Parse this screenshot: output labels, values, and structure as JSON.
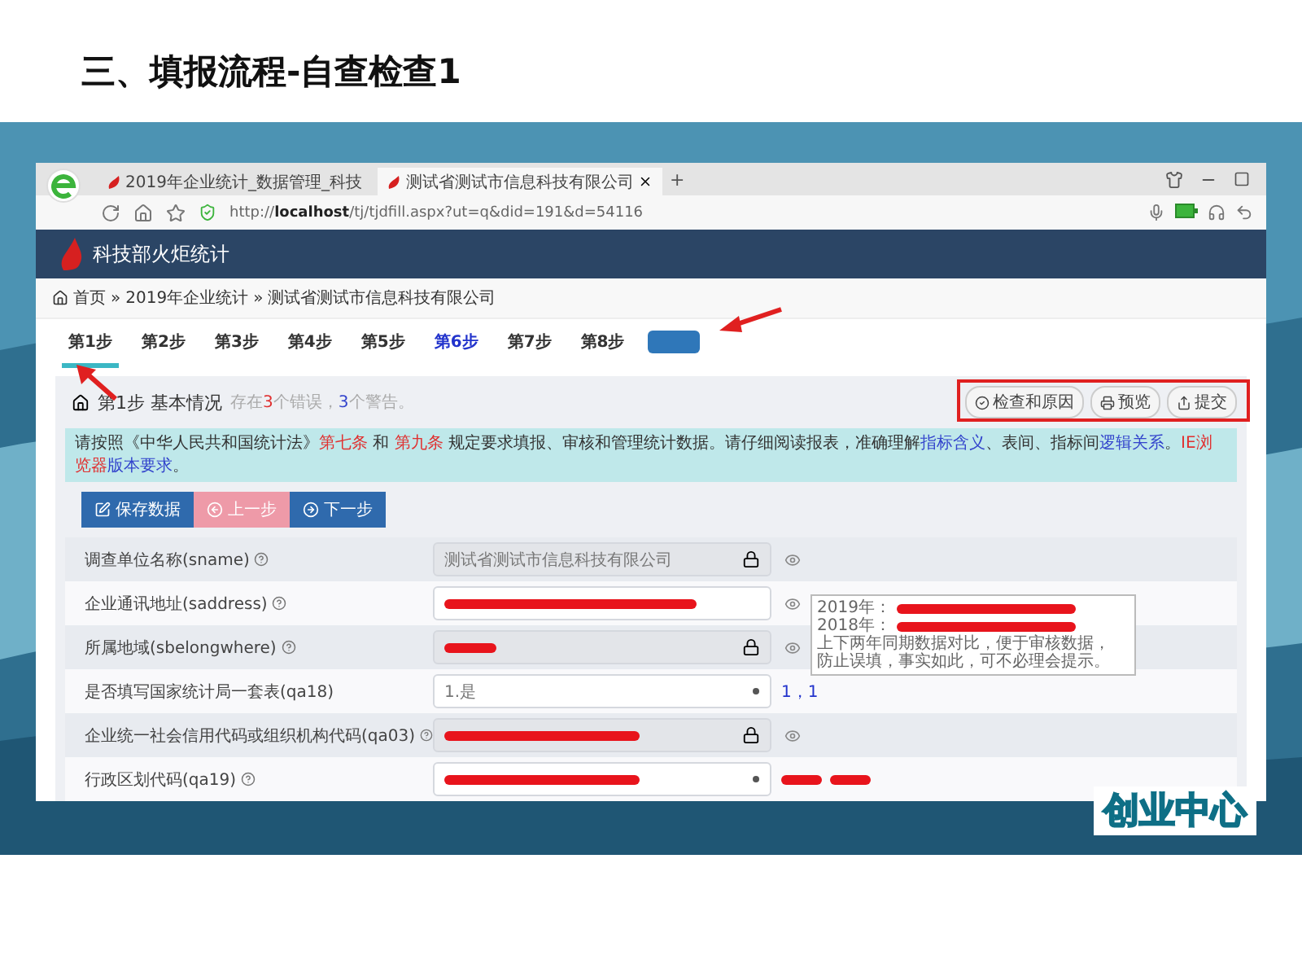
{
  "slide_title": "三、填报流程-自查检查1",
  "browser": {
    "tabs": [
      {
        "title": "2019年企业统计_数据管理_科技",
        "selected": false,
        "closable": false
      },
      {
        "title": "测试省测试市信息科技有限公司",
        "selected": true,
        "closable": true
      }
    ],
    "new_tab": "+",
    "url": {
      "scheme": "http://",
      "host": "localhost",
      "path": "/tj/tjdfill.aspx?ut=q&did=191&d=54116"
    }
  },
  "site": {
    "title": "科技部火炬统计",
    "breadcrumb": [
      "首页",
      "2019年企业统计",
      "测试省测试市信息科技有限公司"
    ],
    "breadcrumb_separator": "»",
    "steps": [
      {
        "label": "第1步",
        "selected": true,
        "highlighted": false
      },
      {
        "label": "第2步",
        "selected": false,
        "highlighted": false
      },
      {
        "label": "第3步",
        "selected": false,
        "highlighted": false
      },
      {
        "label": "第4步",
        "selected": false,
        "highlighted": false
      },
      {
        "label": "第5步",
        "selected": false,
        "highlighted": false
      },
      {
        "label": "第6步",
        "selected": false,
        "highlighted": true
      },
      {
        "label": "第7步",
        "selected": false,
        "highlighted": false
      },
      {
        "label": "第8步",
        "selected": false,
        "highlighted": false
      },
      {
        "kind": "blank"
      }
    ],
    "panel_title": "第1步 基本情况",
    "status": [
      {
        "text": "存在",
        "kind": "plain"
      },
      {
        "text": "3",
        "kind": "error"
      },
      {
        "text": "个错误，",
        "kind": "plain"
      },
      {
        "text": "3",
        "kind": "warning"
      },
      {
        "text": "个警告。",
        "kind": "plain"
      }
    ],
    "actions": [
      "检查和原因",
      "预览",
      "提交"
    ],
    "notice": [
      {
        "text": "请按照《中华人民共和国统计法》",
        "kind": "plain"
      },
      {
        "text": "第七条",
        "kind": "red"
      },
      {
        "text": " 和 ",
        "kind": "plain"
      },
      {
        "text": "第九条",
        "kind": "red"
      },
      {
        "text": " 规定要求填报、审核和管理统计数据。请仔细阅读报表，准确理解",
        "kind": "plain"
      },
      {
        "text": "指标含义",
        "kind": "link"
      },
      {
        "text": "、表间、指标间",
        "kind": "plain"
      },
      {
        "text": "逻辑关系",
        "kind": "link"
      },
      {
        "text": "。",
        "kind": "plain"
      },
      {
        "text": "IE浏览器",
        "kind": "red"
      },
      {
        "text": "版本要求",
        "kind": "link"
      },
      {
        "text": "。",
        "kind": "plain"
      }
    ],
    "buttons": [
      {
        "label": "保存数据",
        "disabled": false,
        "kind": "save"
      },
      {
        "label": "上一步",
        "disabled": true,
        "kind": "prev"
      },
      {
        "label": "下一步",
        "disabled": false,
        "kind": "next"
      }
    ],
    "fields": [
      {
        "label": "调查单位名称(sname)",
        "help": true,
        "kind": "locked",
        "value": "测试省测试市信息科技有限公司",
        "redacted": false,
        "eye": true
      },
      {
        "label": "企业通讯地址(saddress)",
        "help": true,
        "kind": "text",
        "redacted": true,
        "eye": true
      },
      {
        "label": "所属地域(sbelongwhere)",
        "help": true,
        "kind": "locked",
        "redacted": true,
        "eye": true
      },
      {
        "label": "是否填写国家统计局一套表(qa18)",
        "help": false,
        "kind": "select",
        "value": "1.是",
        "redacted": false,
        "eye": false,
        "after": "1，1"
      },
      {
        "label": "企业统一社会信用代码或组织机构代码(qa03)",
        "help": true,
        "kind": "locked",
        "redacted": true,
        "eye": true
      },
      {
        "label": "行政区划代码(qa19)",
        "help": true,
        "kind": "select",
        "redacted": true,
        "eye": false,
        "after_redacted": true
      }
    ],
    "tooltip": [
      {
        "text": "2019年：",
        "redacted": true
      },
      {
        "text": "2018年：",
        "redacted": true
      },
      {
        "text": "上下两年同期数据对比，便于审核数据，",
        "redacted": false
      },
      {
        "text": "防止误填，事实如此，可不必理会提示。",
        "redacted": false
      }
    ]
  },
  "badge": "创业中心"
}
